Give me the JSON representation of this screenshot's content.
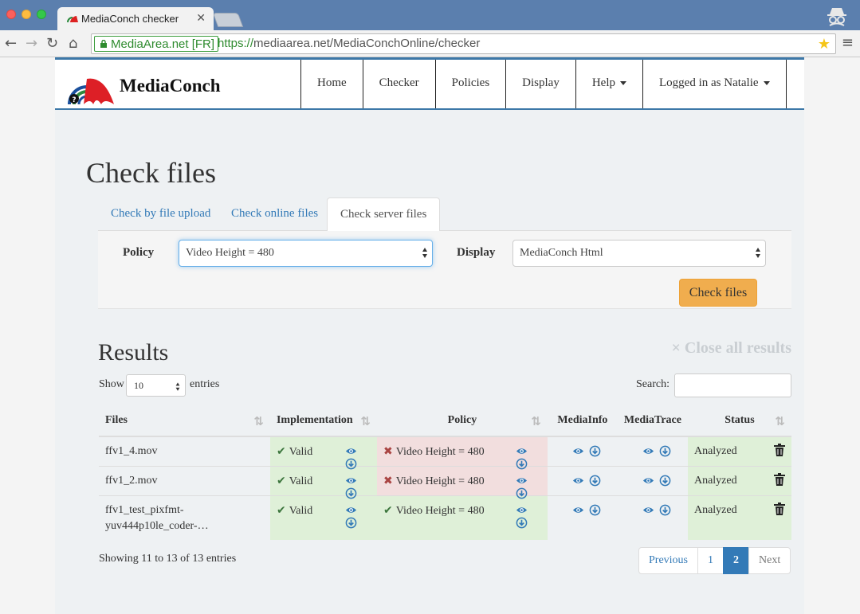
{
  "browser": {
    "tab_title": "MediaConch checker",
    "secure_label": "MediaArea.net [FR]",
    "url_scheme": "https://",
    "url_rest": "mediaarea.net/MediaConchOnline/checker"
  },
  "navbar": {
    "brand": "MediaConch",
    "items": [
      "Home",
      "Checker",
      "Policies",
      "Display",
      "Help",
      "Logged in as Natalie"
    ]
  },
  "page": {
    "title": "Check files",
    "tabs": [
      "Check by file upload",
      "Check online files",
      "Check server files"
    ],
    "form": {
      "policy_label": "Policy",
      "policy_value": "Video Height = 480",
      "display_label": "Display",
      "display_value": "MediaConch Html",
      "submit_label": "Check files"
    }
  },
  "results": {
    "title": "Results",
    "close_all": "× Close all results",
    "show_label": "Show",
    "page_size": "10",
    "entries_label": "entries",
    "search_label": "Search:",
    "columns": [
      "Files",
      "Implementation",
      "Policy",
      "MediaInfo",
      "MediaTrace",
      "Status"
    ],
    "rows": [
      {
        "file": "ffv1_4.mov",
        "file2": "",
        "implementation": "Valid",
        "policy": "Video Height = 480",
        "policy_pass": false,
        "status": "Analyzed"
      },
      {
        "file": "ffv1_2.mov",
        "file2": "",
        "implementation": "Valid",
        "policy": "Video Height = 480",
        "policy_pass": false,
        "status": "Analyzed"
      },
      {
        "file": "ffv1_test_pixfmt-",
        "file2": "yuv444p10le_coder-…",
        "implementation": "Valid",
        "policy": "Video Height = 480",
        "policy_pass": true,
        "status": "Analyzed"
      }
    ],
    "info": "Showing 11 to 13 of 13 entries",
    "pagination": [
      "Previous",
      "1",
      "2",
      "Next"
    ],
    "current_page": "2"
  },
  "colors": {
    "accent": "#337ab7",
    "valid_bg": "#dff0d8",
    "invalid_bg": "#f2dede",
    "warning_btn": "#f0ad4e"
  },
  "icons": [
    "eye-icon",
    "download-icon",
    "trash-icon",
    "check-icon",
    "cross-icon",
    "sort-icon"
  ]
}
